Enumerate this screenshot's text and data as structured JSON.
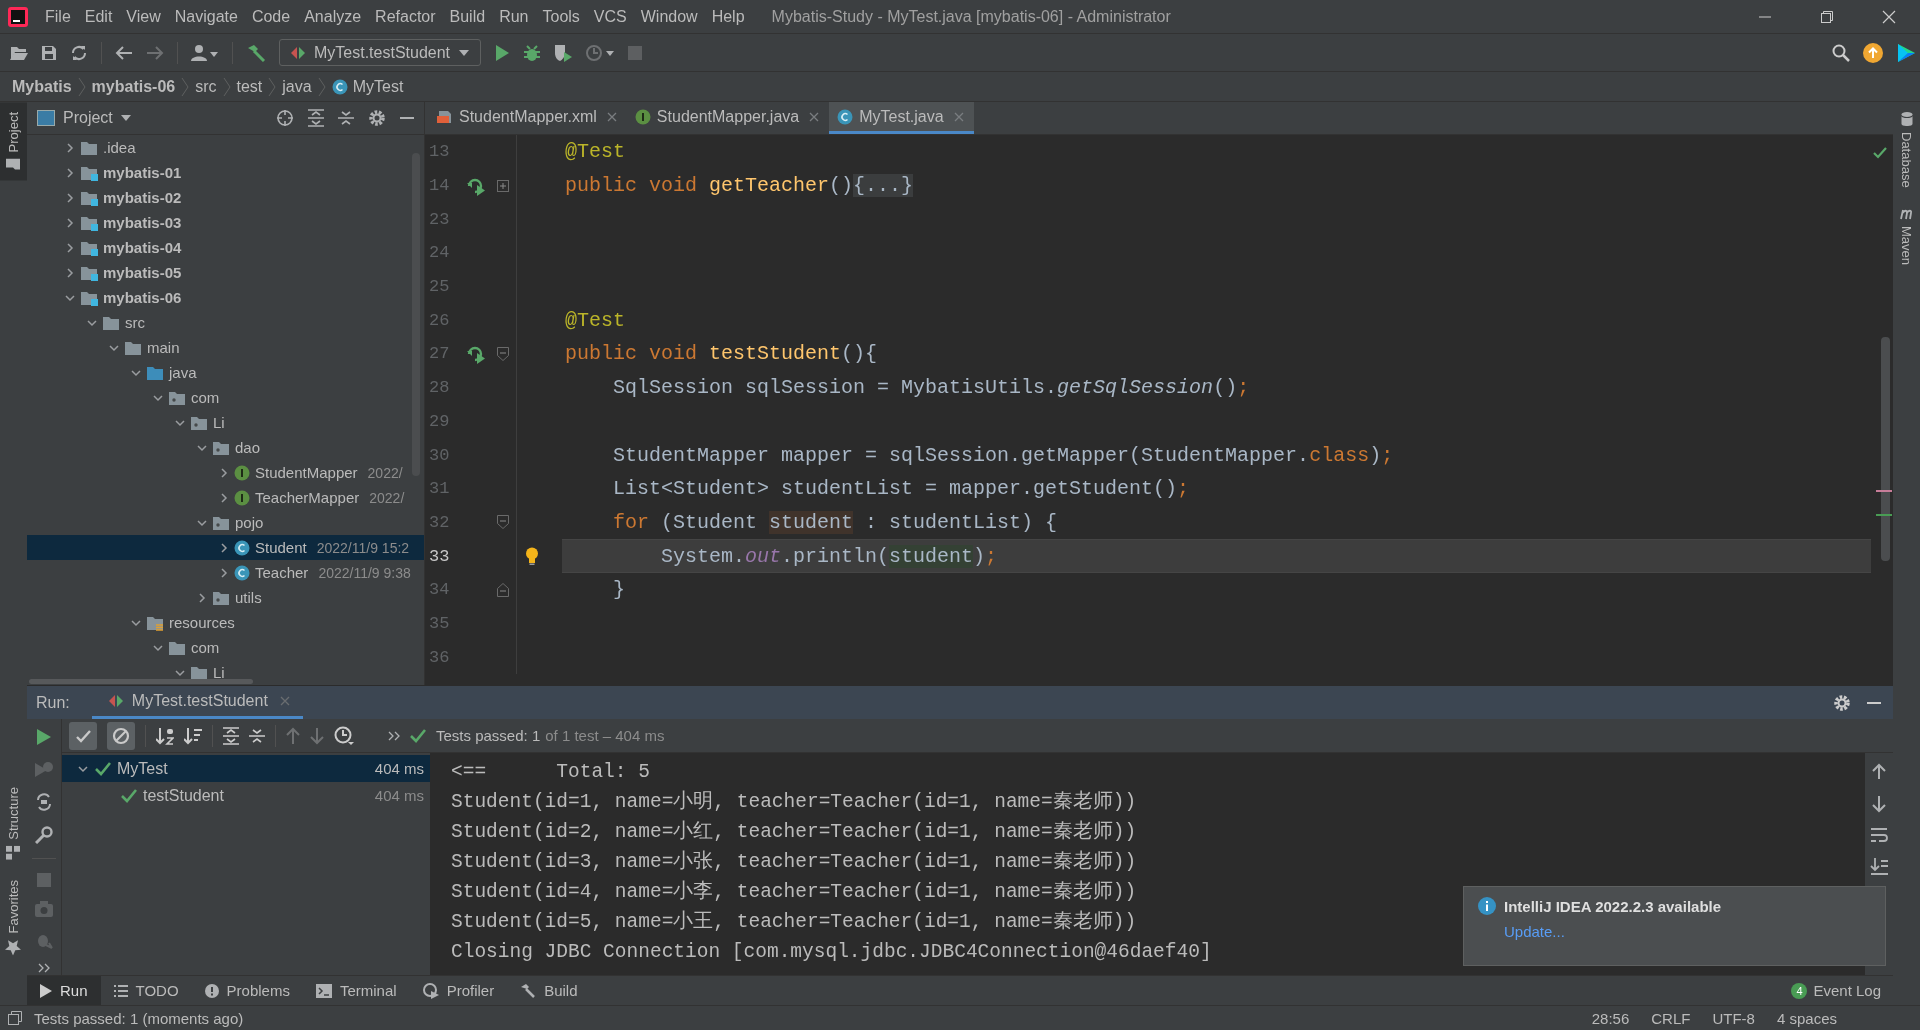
{
  "window": {
    "title": "Mybatis-Study - MyTest.java [mybatis-06] - Administrator"
  },
  "menu": [
    "File",
    "Edit",
    "View",
    "Navigate",
    "Code",
    "Analyze",
    "Refactor",
    "Build",
    "Run",
    "Tools",
    "VCS",
    "Window",
    "Help"
  ],
  "toolbar": {
    "run_configuration": "MyTest.testStudent"
  },
  "breadcrumbs": [
    {
      "label": "Mybatis",
      "kind": "project"
    },
    {
      "label": "mybatis-06",
      "kind": "module"
    },
    {
      "label": "src",
      "kind": "folder"
    },
    {
      "label": "test",
      "kind": "folder"
    },
    {
      "label": "java",
      "kind": "folder"
    },
    {
      "label": "MyTest",
      "kind": "class"
    }
  ],
  "left_stripe": {
    "top": [
      {
        "label": "Project",
        "kind": "project",
        "selected": true
      }
    ],
    "bottom": [
      {
        "label": "Structure",
        "kind": "structure",
        "selected": false
      },
      {
        "label": "Favorites",
        "kind": "favorites",
        "selected": false
      }
    ]
  },
  "right_stripe": [
    {
      "label": "Database",
      "kind": "database"
    },
    {
      "label": "Maven",
      "kind": "maven"
    }
  ],
  "project_panel": {
    "title": "Project",
    "tree": [
      {
        "label": ".idea",
        "kind": "folder",
        "expanded": false,
        "selected": false
      },
      {
        "label": "mybatis-01",
        "kind": "module",
        "expanded": false,
        "selected": false
      },
      {
        "label": "mybatis-02",
        "kind": "module",
        "expanded": false,
        "selected": false
      },
      {
        "label": "mybatis-03",
        "kind": "module",
        "expanded": false,
        "selected": false
      },
      {
        "label": "mybatis-04",
        "kind": "module",
        "expanded": false,
        "selected": false
      },
      {
        "label": "mybatis-05",
        "kind": "module",
        "expanded": false,
        "selected": false
      },
      {
        "label": "mybatis-06",
        "kind": "module",
        "expanded": true,
        "selected": false,
        "children": [
          {
            "label": "src",
            "kind": "folder",
            "expanded": true,
            "selected": false,
            "children": [
              {
                "label": "main",
                "kind": "folder",
                "expanded": true,
                "selected": false,
                "children": [
                  {
                    "label": "java",
                    "kind": "source",
                    "expanded": true,
                    "selected": false,
                    "children": [
                      {
                        "label": "com",
                        "kind": "package",
                        "expanded": true,
                        "selected": false,
                        "children": [
                          {
                            "label": "Li",
                            "kind": "package",
                            "expanded": true,
                            "selected": false,
                            "children": [
                              {
                                "label": "dao",
                                "kind": "package",
                                "expanded": true,
                                "selected": false,
                                "children": [
                                  {
                                    "label": "StudentMapper",
                                    "kind": "interface",
                                    "date": "2022/",
                                    "expanded": false,
                                    "selected": false
                                  },
                                  {
                                    "label": "TeacherMapper",
                                    "kind": "interface",
                                    "date": "2022/",
                                    "expanded": false,
                                    "selected": false
                                  }
                                ]
                              },
                              {
                                "label": "pojo",
                                "kind": "package",
                                "expanded": true,
                                "selected": false,
                                "children": [
                                  {
                                    "label": "Student",
                                    "kind": "class",
                                    "date": "2022/11/9 15:2",
                                    "expanded": false,
                                    "selected": true
                                  },
                                  {
                                    "label": "Teacher",
                                    "kind": "class",
                                    "date": "2022/11/9 9:38",
                                    "expanded": false,
                                    "selected": false
                                  }
                                ]
                              },
                              {
                                "label": "utils",
                                "kind": "package",
                                "expanded": false,
                                "selected": false
                              }
                            ]
                          }
                        ]
                      }
                    ]
                  },
                  {
                    "label": "resources",
                    "kind": "resources",
                    "expanded": true,
                    "selected": false,
                    "children": [
                      {
                        "label": "com",
                        "kind": "folder",
                        "expanded": true,
                        "selected": false,
                        "children": [
                          {
                            "label": "Li",
                            "kind": "folder",
                            "expanded": true,
                            "selected": false
                          }
                        ]
                      }
                    ]
                  }
                ]
              }
            ]
          }
        ]
      }
    ]
  },
  "editor": {
    "tabs": [
      {
        "label": "StudentMapper.xml",
        "kind": "xml",
        "selected": false
      },
      {
        "label": "StudentMapper.java",
        "kind": "interface",
        "selected": false
      },
      {
        "label": "MyTest.java",
        "kind": "class",
        "selected": true
      }
    ],
    "lines": [
      {
        "number": "13",
        "current": false,
        "tokens": [
          {
            "text": "@Test",
            "kind": "annotation"
          }
        ]
      },
      {
        "number": "14",
        "current": false,
        "gutter": {
          "kind": "run"
        },
        "fold": {
          "kind": "folded"
        },
        "tokens": [
          {
            "text": "public void ",
            "kind": "keyword"
          },
          {
            "text": "getTeacher",
            "kind": "declaration"
          },
          {
            "text": "()",
            "kind": "plain"
          },
          {
            "text": "{...}",
            "kind": "folded"
          }
        ]
      },
      {
        "number": "23",
        "current": false
      },
      {
        "number": "24",
        "current": false
      },
      {
        "number": "25",
        "current": false
      },
      {
        "number": "26",
        "current": false,
        "tokens": [
          {
            "text": "@Test",
            "kind": "annotation"
          }
        ]
      },
      {
        "number": "27",
        "current": false,
        "gutter": {
          "kind": "run"
        },
        "fold": {
          "kind": "start"
        },
        "tokens": [
          {
            "text": "public void ",
            "kind": "keyword"
          },
          {
            "text": "testStudent",
            "kind": "declaration"
          },
          {
            "text": "(){",
            "kind": "plain"
          }
        ]
      },
      {
        "number": "28",
        "current": false,
        "tokens": [
          {
            "text": "    SqlSession sqlSession = MybatisUtils.",
            "kind": "plain"
          },
          {
            "text": "getSqlSession",
            "kind": "static_call"
          },
          {
            "text": "()",
            "kind": "plain"
          },
          {
            "text": ";",
            "kind": "keyword"
          }
        ]
      },
      {
        "number": "29",
        "current": false
      },
      {
        "number": "30",
        "current": false,
        "tokens": [
          {
            "text": "    StudentMapper mapper = sqlSession.getMapper(StudentMapper.",
            "kind": "plain"
          },
          {
            "text": "class",
            "kind": "keyword"
          },
          {
            "text": ")",
            "kind": "plain"
          },
          {
            "text": ";",
            "kind": "keyword"
          }
        ]
      },
      {
        "number": "31",
        "current": false,
        "tokens": [
          {
            "text": "    List<Student> studentList = mapper.getStudent()",
            "kind": "plain"
          },
          {
            "text": ";",
            "kind": "keyword"
          }
        ]
      },
      {
        "number": "32",
        "current": false,
        "fold": {
          "kind": "start"
        },
        "tokens": [
          {
            "text": "    for",
            "kind": "keyword"
          },
          {
            "text": " (Student ",
            "kind": "plain"
          },
          {
            "text": "student",
            "kind": "write_highlight"
          },
          {
            "text": " : studentList) {",
            "kind": "plain"
          }
        ]
      },
      {
        "number": "33",
        "current": true,
        "gutter": {
          "kind": "bulb"
        },
        "tokens": [
          {
            "text": "        System.",
            "kind": "plain"
          },
          {
            "text": "out",
            "kind": "static_field"
          },
          {
            "text": ".println(",
            "kind": "plain"
          },
          {
            "text": "student",
            "kind": "read_highlight"
          },
          {
            "text": ")",
            "kind": "plain"
          },
          {
            "text": ";",
            "kind": "keyword"
          }
        ]
      },
      {
        "number": "34",
        "current": false,
        "fold": {
          "kind": "end"
        },
        "tokens": [
          {
            "text": "    }",
            "kind": "plain"
          }
        ]
      },
      {
        "number": "35",
        "current": false
      },
      {
        "number": "36",
        "current": false
      }
    ]
  },
  "run_panel": {
    "label": "Run:",
    "tabs": [
      {
        "label": "MyTest.testStudent",
        "selected": true
      }
    ],
    "toggles": [
      {
        "kind": "passed",
        "on": true
      },
      {
        "kind": "ignored",
        "on": true
      }
    ],
    "status": {
      "summary": "Tests passed: 1",
      "detail": "of 1 test – 404 ms"
    },
    "tests": [
      {
        "label": "MyTest",
        "time": "404 ms",
        "passed": true,
        "expanded": true,
        "selected": true,
        "children": [
          {
            "label": "testStudent",
            "time": "404 ms",
            "passed": true,
            "selected": false
          }
        ]
      }
    ],
    "console": [
      "<==      Total: 5",
      "Student(id=1, name=小明, teacher=Teacher(id=1, name=秦老师))",
      "Student(id=2, name=小红, teacher=Teacher(id=1, name=秦老师))",
      "Student(id=3, name=小张, teacher=Teacher(id=1, name=秦老师))",
      "Student(id=4, name=小李, teacher=Teacher(id=1, name=秦老师))",
      "Student(id=5, name=小王, teacher=Teacher(id=1, name=秦老师))",
      "Closing JDBC Connection [com.mysql.jdbc.JDBC4Connection@46daef40]"
    ],
    "notification": {
      "title": "IntelliJ IDEA 2022.2.3 available",
      "link": "Update..."
    }
  },
  "bottom_tabs": [
    {
      "label": "Run",
      "kind": "run",
      "selected": true
    },
    {
      "label": "TODO",
      "kind": "todo",
      "selected": false
    },
    {
      "label": "Problems",
      "kind": "problems",
      "selected": false
    },
    {
      "label": "Terminal",
      "kind": "terminal",
      "selected": false
    },
    {
      "label": "Profiler",
      "kind": "profiler",
      "selected": false
    },
    {
      "label": "Build",
      "kind": "build",
      "selected": false
    }
  ],
  "event_log": {
    "label": "Event Log",
    "count": "4"
  },
  "status_bar": {
    "message": "Tests passed: 1 (moments ago)",
    "items": [
      "28:56",
      "CRLF",
      "UTF-8",
      "4 spaces"
    ]
  }
}
